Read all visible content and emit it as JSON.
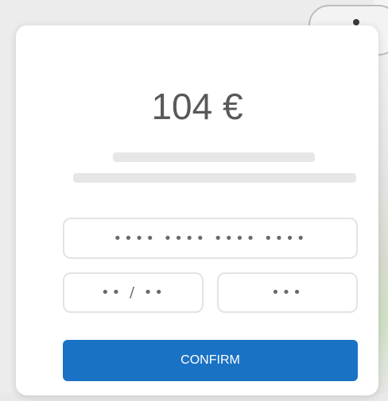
{
  "payment": {
    "amount": "104 €",
    "card_number_placeholder": "•••• •••• •••• ••••",
    "expiry_placeholder": "•• / ••",
    "cvc_placeholder": "•••",
    "confirm_label": "CONFIRM"
  },
  "colors": {
    "accent": "#1a72c4",
    "amount_text": "#595959",
    "field_border": "#e3e3e3",
    "skeleton": "#e6e6e6"
  }
}
